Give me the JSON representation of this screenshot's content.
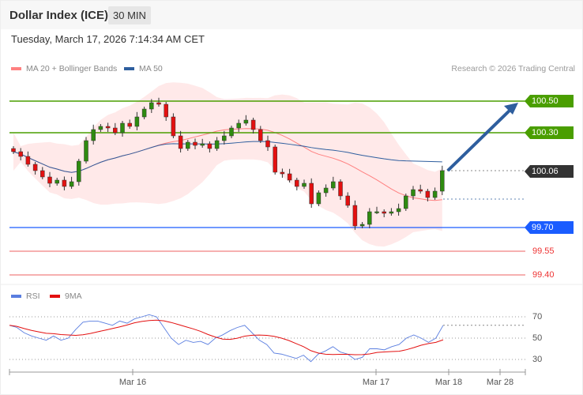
{
  "header": {
    "title": "Dollar Index (ICE)",
    "timeframe": "30 MIN"
  },
  "date": "Tuesday, March 17, 2026 7:14:34 AM CET",
  "legend": {
    "ma20": "MA 20 + Bollinger Bands",
    "ma50": "MA 50",
    "ma20_color": "#ff8080",
    "ma50_color": "#2e5e9e"
  },
  "credit": "Research © 2026 Trading Central",
  "levels": {
    "r2": "100.50",
    "r1": "100.30",
    "current": "100.06",
    "pivot": "99.70",
    "s1": "99.55",
    "s2": "99.40"
  },
  "rsi_legend": {
    "rsi": "RSI",
    "ma": "9MA"
  },
  "rsi_levels": [
    "70",
    "50",
    "30"
  ],
  "x_labels": [
    "Mar 16",
    "Mar 17",
    "Mar 18",
    "Mar 28"
  ],
  "colors": {
    "up": "#2e8b10",
    "down": "#e31010",
    "resistance": "#4a9e00",
    "pivot": "#1a5cff",
    "support": "#f08080",
    "current": "#333333"
  },
  "chart_data": {
    "type": "candlestick",
    "closes": [
      100.18,
      100.15,
      100.1,
      100.06,
      100.02,
      99.98,
      100.0,
      99.96,
      99.99,
      100.12,
      100.25,
      100.32,
      100.34,
      100.33,
      100.3,
      100.36,
      100.34,
      100.4,
      100.45,
      100.49,
      100.48,
      100.4,
      100.28,
      100.2,
      100.24,
      100.22,
      100.23,
      100.2,
      100.25,
      100.28,
      100.33,
      100.36,
      100.38,
      100.32,
      100.25,
      100.21,
      100.05,
      100.04,
      100.0,
      99.96,
      99.98,
      99.85,
      99.92,
      99.95,
      99.99,
      99.9,
      99.84,
      99.71,
      99.72,
      99.8,
      99.8,
      99.79,
      99.8,
      99.82,
      99.9,
      99.94,
      99.93,
      99.89,
      99.93,
      100.06
    ],
    "rsi": [
      62,
      60,
      55,
      52,
      50,
      48,
      52,
      48,
      50,
      58,
      65,
      66,
      66,
      64,
      62,
      66,
      64,
      68,
      70,
      72,
      70,
      60,
      50,
      44,
      48,
      46,
      47,
      44,
      50,
      53,
      57,
      60,
      62,
      55,
      48,
      44,
      36,
      35,
      33,
      31,
      34,
      28,
      35,
      38,
      42,
      37,
      35,
      30,
      32,
      40,
      40,
      39,
      42,
      44,
      50,
      53,
      50,
      46,
      50,
      62
    ],
    "levels": [
      100.5,
      100.3,
      100.06,
      99.7,
      99.55,
      99.4
    ],
    "rsi_levels": [
      70,
      50,
      30
    ],
    "target_arrow": {
      "from": 100.06,
      "to": 100.5
    }
  }
}
